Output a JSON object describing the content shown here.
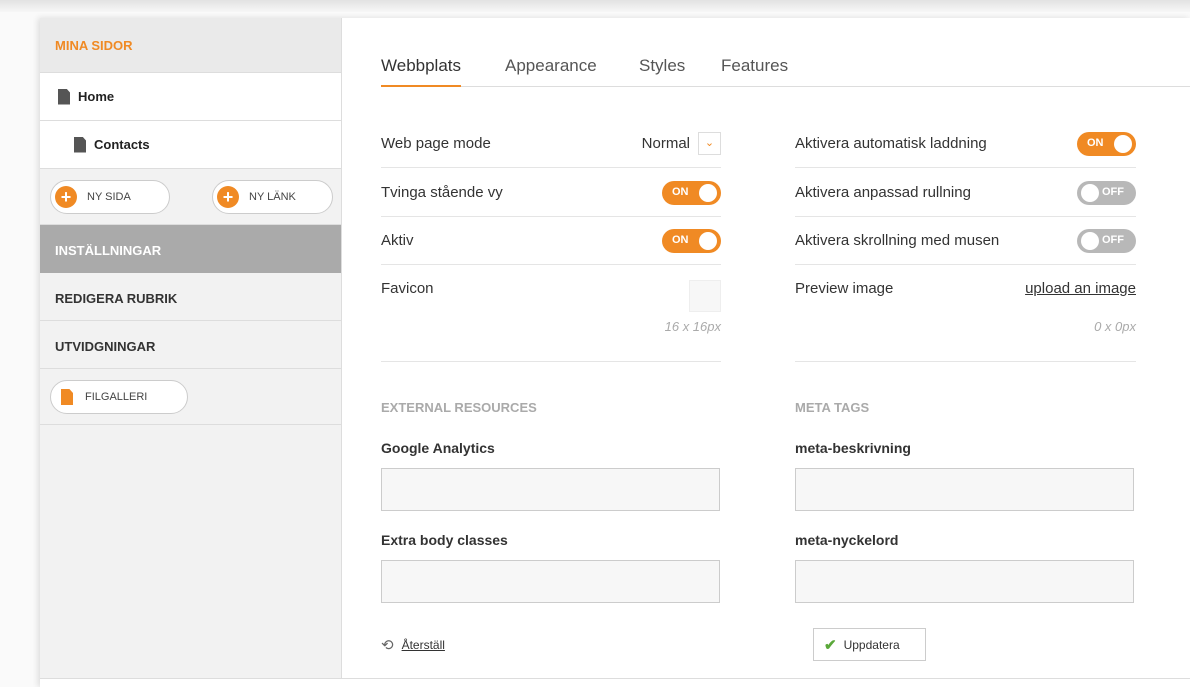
{
  "sidebar": {
    "title": "MINA SIDOR",
    "pages": [
      {
        "label": "Home"
      },
      {
        "label": "Contacts"
      }
    ],
    "buttons": {
      "new_page": "NY SIDA",
      "new_link": "NY LÄNK",
      "file_gallery": "FILGALLERI"
    },
    "sections": [
      {
        "label": "INSTÄLLNINGAR",
        "active": true
      },
      {
        "label": "REDIGERA RUBRIK"
      },
      {
        "label": "UTVIDGNINGAR"
      }
    ]
  },
  "tabs": [
    "Webbplats",
    "Appearance",
    "Styles",
    "Features"
  ],
  "settings_left": {
    "page_mode_label": "Web page mode",
    "page_mode_value": "Normal",
    "force_portrait_label": "Tvinga stående vy",
    "force_portrait_state": "ON",
    "active_label": "Aktiv",
    "active_state": "ON",
    "favicon_label": "Favicon",
    "favicon_size": "16 x 16px"
  },
  "settings_right": {
    "auto_load_label": "Aktivera automatisk laddning",
    "auto_load_state": "ON",
    "custom_scroll_label": "Aktivera anpassad rullning",
    "custom_scroll_state": "OFF",
    "mouse_scroll_label": "Aktivera skrollning med musen",
    "mouse_scroll_state": "OFF",
    "preview_label": "Preview image",
    "preview_link": "upload an image",
    "preview_size": "0 x 0px"
  },
  "external": {
    "title": "EXTERNAL RESOURCES",
    "ga_label": "Google Analytics",
    "ga_value": "",
    "body_classes_label": "Extra body classes",
    "body_classes_value": ""
  },
  "meta": {
    "title": "META TAGS",
    "description_label": "meta-beskrivning",
    "description_value": "",
    "keywords_label": "meta-nyckelord",
    "keywords_value": ""
  },
  "actions": {
    "reset": "Återställ",
    "update": "Uppdatera"
  },
  "colors": {
    "accent": "#f08a24",
    "toggle_off": "#b8b8b8",
    "active_section": "#aaaaaa",
    "check": "#5aa83a"
  }
}
